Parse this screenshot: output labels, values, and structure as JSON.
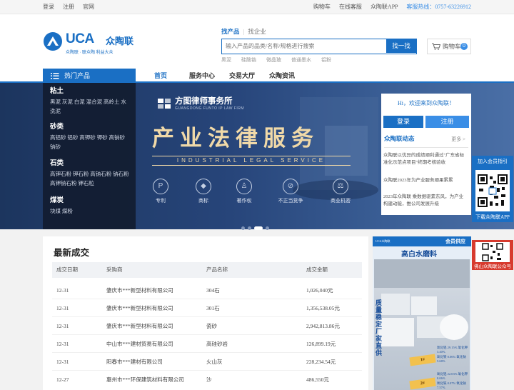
{
  "topbar": {
    "left": [
      "登录",
      "注册",
      "官网"
    ],
    "right": [
      "购物车",
      "在线客服",
      "众陶联APP"
    ],
    "hotline": "客服热线：0757-63226912"
  },
  "logo": {
    "brand": "UCA",
    "cn": "众陶联",
    "slogan": "众陶联 · 联众陶   利益大众"
  },
  "search": {
    "tab_active": "找产品",
    "tab_other": "找企业",
    "placeholder": "输入产品的品类/名称/规格进行搜索",
    "button": "找一找",
    "hotwords": [
      "黑泥",
      "硅酸锆",
      "微晶玻",
      "普通墨水",
      "铝粉"
    ]
  },
  "cart": {
    "label": "购物车",
    "count": "0"
  },
  "nav": {
    "hot_categories": "热门产品",
    "items": [
      "首页",
      "服务中心",
      "交易大厅",
      "众陶资讯"
    ]
  },
  "categories": [
    {
      "title": "粘土",
      "items": "黑泥 灰泥 白泥 混合泥 高岭土 水洗泥"
    },
    {
      "title": "砂类",
      "items": "高铝砂 铝砂 高钾砂 钾砂 高钠砂 钠砂"
    },
    {
      "title": "石类",
      "items": "高钾石粉 钾石粉 高钠石粉 钠石粉 高钾钠石粉 钾石粒"
    },
    {
      "title": "煤炭",
      "items": "块煤 煤粉"
    }
  ],
  "banner": {
    "firm": "方图律师事务所",
    "firm_en": "GUANGDONG FUNTO IP LAW FIRM",
    "title": "产业法律服务",
    "subtitle": "INDUSTRIAL LEGAL SERVICE",
    "services": [
      {
        "label": "专利",
        "icon": "patent-icon",
        "glyph": "P"
      },
      {
        "label": "商标",
        "icon": "trademark-icon",
        "glyph": "◆"
      },
      {
        "label": "著作权",
        "icon": "copyright-icon",
        "glyph": "♙"
      },
      {
        "label": "不正当竞争",
        "icon": "competition-icon",
        "glyph": "⊘"
      },
      {
        "label": "商业机密",
        "icon": "secret-icon",
        "glyph": "⚖"
      }
    ]
  },
  "welcome": {
    "greeting": "Hi，欢迎来到众陶联！",
    "login": "登录",
    "register": "注册",
    "news_title": "众陶联动态",
    "more": "更多 >",
    "news": [
      "众陶联以优异的成绩顺利通过\"广东省标准化示范点项目\"终期考核验收",
      "众陶联2023年为产业服务顺果累累",
      "2023年众陶联 乘数据驱素东风，为产业构建动能，推公司发展升级"
    ]
  },
  "float": {
    "join": "加入会员指引",
    "download": "下载众陶联APP",
    "wechat": "佛山众陶联公众号"
  },
  "deals": {
    "title": "最新成交",
    "headers": [
      "成交日期",
      "采购商",
      "产品名称",
      "成交金额"
    ],
    "rows": [
      [
        "12-31",
        "肇庆市***新型材料有限公司",
        "304石",
        "1,026,040元"
      ],
      [
        "12-31",
        "肇庆市***新型材料有限公司",
        "301石",
        "1,356,538.05元"
      ],
      [
        "12-31",
        "肇庆市***新型材料有限公司",
        "瓷砂",
        "2,942,813.86元"
      ],
      [
        "12-31",
        "中山市***建材贸易有限公司",
        "高硅砂岩",
        "126,899.19元"
      ],
      [
        "12-31",
        "阳春市***建材有限公司",
        "火山灰",
        "228,234.54元"
      ],
      [
        "12-27",
        "惠州市***环保建筑材料有限公司",
        "沙",
        "486,550元"
      ]
    ]
  },
  "ad": {
    "supply": "会员供应",
    "mini_logo": "UCA众陶联",
    "product": "高白水磨料",
    "slogan": "质量稳定厂家直供",
    "tag1": "1#",
    "tag2": "2#",
    "specs": [
      "氧化铝 29.15%  氧化钾 3.40%",
      "氧化铁 0.06%  氧化钠 5.68%",
      "氧化铝 22.03%  氧化钾 0.06%",
      "氧化铁 0.07%  氧化钠 7.57%"
    ]
  }
}
